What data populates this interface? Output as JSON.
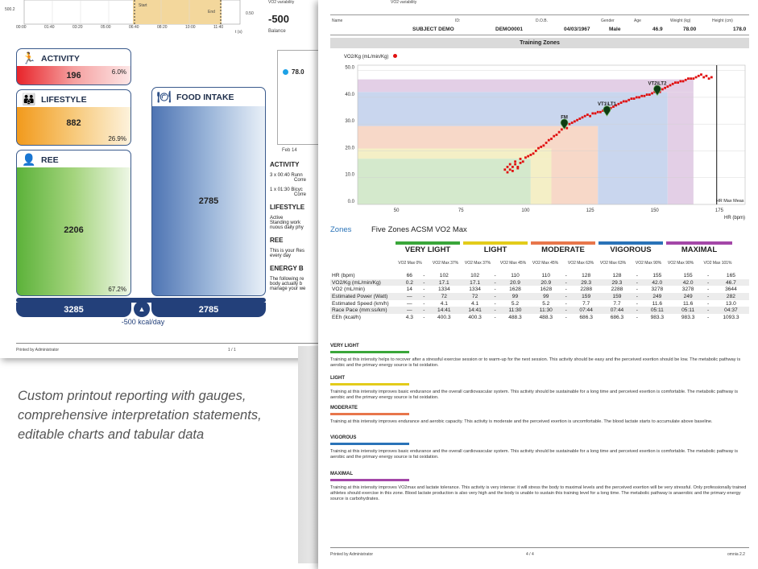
{
  "back": {
    "top_chart": {
      "y_tick_500": "500.2",
      "x_ticks": [
        "00:00",
        "01:40",
        "03:20",
        "05:00",
        "06:40",
        "08:20",
        "10:00",
        "11:40"
      ],
      "t_unit": "t (s)",
      "start_label": "Start",
      "end_label": "End",
      "right_tick": "0.50"
    },
    "balance_top_label": "VO2 variability",
    "balance_value": "-500",
    "balance_label": "Balance",
    "activity": {
      "label": "ACTIVITY",
      "value": "196",
      "pct": "6.0%"
    },
    "lifestyle": {
      "label": "LIFESTYLE",
      "value": "882",
      "pct": "26.9%"
    },
    "ree": {
      "label": "REE",
      "value": "2206",
      "pct": "67.2%"
    },
    "food": {
      "label": "FOOD INTAKE",
      "value": "2785"
    },
    "totals": {
      "left": "3285",
      "right": "2785",
      "balance": "-500 kcal/day"
    },
    "mini_chart": {
      "value": "78.0",
      "x_label": "Feb 14"
    },
    "side_sections": [
      {
        "title": "ACTIVITY",
        "lines": [
          "3 x 00:40  Runn",
          "Corre",
          "1 x 01:30  Bicyc",
          "Corre"
        ]
      },
      {
        "title": "LIFESTYLE",
        "lines": [
          "Active",
          "Standing work",
          "nuous daily phy"
        ]
      },
      {
        "title": "REE",
        "lines": [
          "This is your Res",
          "every day"
        ]
      },
      {
        "title": "ENERGY B",
        "lines": [
          "The following re",
          "body actually b",
          "manage your we"
        ]
      }
    ],
    "footer_left": "Printed by Administrator",
    "footer_page": "1 / 1"
  },
  "caption": "Custom printout reporting with gauges, comprehensive interpretation statements, editable charts and tabular data",
  "front": {
    "header_top_text": "VO2 variability",
    "subject": {
      "name_label": "Name",
      "name": "SUBJECT DEMO",
      "id_label": "ID:",
      "id": "DEMO0001",
      "dob_label": "D.O.B.",
      "dob": "04/03/1967",
      "gender_label": "Gender",
      "gender": "Male",
      "age_label": "Age",
      "age": "46.9",
      "weight_label": "Weight (kg)",
      "weight": "78.00",
      "height_label": "Height (cm)",
      "height": "178.0"
    },
    "section_title": "Training Zones",
    "zones_label": "Zones",
    "zones_title": "Five Zones ACSM VO2 Max",
    "zones": [
      {
        "name": "VERY LIGHT",
        "color": "#3aa63a",
        "sub1": "VO2 Max 0%",
        "sub2": "VO2 Max 37%"
      },
      {
        "name": "LIGHT",
        "color": "#e3cc1a",
        "sub1": "VO2 Max 37%",
        "sub2": "VO2 Max 45%"
      },
      {
        "name": "MODERATE",
        "color": "#e8764b",
        "sub1": "VO2 Max 45%",
        "sub2": "VO2 Max 63%"
      },
      {
        "name": "VIGOROUS",
        "color": "#2a73b8",
        "sub1": "VO2 Max 63%",
        "sub2": "VO2 Max 90%"
      },
      {
        "name": "MAXIMAL",
        "color": "#a447a8",
        "sub1": "VO2 Max 90%",
        "sub2": "VO2 Max 101%"
      }
    ],
    "table_rows": [
      {
        "label": "HR (bpm)",
        "cells": [
          "66",
          "-",
          "102",
          "102",
          "-",
          "110",
          "110",
          "-",
          "128",
          "128",
          "-",
          "155",
          "155",
          "-",
          "165"
        ]
      },
      {
        "label": "VO2/Kg (mL/min/Kg)",
        "cells": [
          "0.2",
          "-",
          "17.1",
          "17.1",
          "-",
          "20.9",
          "20.9",
          "-",
          "29.3",
          "29.3",
          "-",
          "42.0",
          "42.0",
          "-",
          "46.7"
        ]
      },
      {
        "label": "VO2 (mL/min)",
        "cells": [
          "14",
          "-",
          "1334",
          "1334",
          "-",
          "1628",
          "1628",
          "-",
          "2288",
          "2288",
          "-",
          "3278",
          "3278",
          "-",
          "3644"
        ]
      },
      {
        "label": "Estimated Power (Watt)",
        "cells": [
          "—",
          "-",
          "72",
          "72",
          "-",
          "99",
          "99",
          "-",
          "159",
          "159",
          "-",
          "249",
          "249",
          "-",
          "282"
        ]
      },
      {
        "label": "Estimated Speed (km/h)",
        "cells": [
          "—",
          "-",
          "4.1",
          "4.1",
          "-",
          "5.2",
          "5.2",
          "-",
          "7.7",
          "7.7",
          "-",
          "11.6",
          "11.6",
          "-",
          "13.0"
        ]
      },
      {
        "label": "Race Pace (mm:ss/km)",
        "cells": [
          "—",
          "-",
          "14:41",
          "14:41",
          "-",
          "11:30",
          "11:30",
          "-",
          "07:44",
          "07:44",
          "-",
          "05:11",
          "05:11",
          "-",
          "04:37"
        ]
      },
      {
        "label": "EEh (kcal/h)",
        "cells": [
          "4.3",
          "-",
          "400.3",
          "400.3",
          "-",
          "488.3",
          "488.3",
          "-",
          "686.3",
          "686.3",
          "-",
          "983.3",
          "983.3",
          "-",
          "1093.3"
        ]
      }
    ],
    "descriptions": [
      {
        "title": "VERY LIGHT",
        "color": "#3aa63a",
        "text": "Training at this intensity helps to recover after a stressful exercise session or to warm-up for the next session. This activity should be easy and the perceived exertion should be low. The metabolic pathway is aerobic and the primary energy source is fat oxidation."
      },
      {
        "title": "LIGHT",
        "color": "#e3cc1a",
        "text": "Training at this intensity improves basic endurance and the overall cardiovascular system. This activity should be sustainable for a long time and perceived exertion is comfortable. The metabolic pathway is aerobic and the primary energy source is fat oxidation."
      },
      {
        "title": "MODERATE",
        "color": "#e8764b",
        "text": "Training at this intensity improves endurance and aerobic capacity. This activity is moderate and the perceived exertion is uncomfortable. The blood lactate starts to accumulate above baseline."
      },
      {
        "title": "VIGOROUS",
        "color": "#2a73b8",
        "text": "Training at this intensity improves basic endurance and the overall cardiovascular system. This activity should be sustainable for a long time and perceived exertion is comfortable. The metabolic pathway is aerobic and the primary energy source is fat oxidation."
      },
      {
        "title": "MAXIMAL",
        "color": "#a447a8",
        "text": "Training at this intensity improves VO2max and lactate tolerance. This activity is very intense: it will stress the body to maximal levels and the perceived exertion will be very stressful. Only professionally trained athletes should exercise in this zone. Blood lactate production is also very high and the body is unable to sustain this training level for a long time. The metabolic pathway is anaerobic and the primary energy source is carbohydrates."
      }
    ],
    "footer_left": "Printed by Administrator",
    "footer_page": "4 / 4",
    "footer_right": "omnia 2.2"
  },
  "chart_data": {
    "type": "scatter",
    "ylabel": "VO2/Kg (mL/min/Kg)",
    "xlabel": "HR (bpm)",
    "xlim": [
      35,
      185
    ],
    "ylim": [
      0,
      52
    ],
    "x_ticks": [
      50,
      75,
      100,
      125,
      150,
      175
    ],
    "y_ticks": [
      "0.0",
      "10.0",
      "20.0",
      "30.0",
      "40.0",
      "50.0"
    ],
    "zone_hr_bounds": [
      102,
      110,
      128,
      155,
      165
    ],
    "zone_vo2_bounds": [
      17.1,
      20.9,
      29.3,
      42.0,
      46.7
    ],
    "zone_colors": [
      "#d4e9cc",
      "#f4efc6",
      "#f7d8c8",
      "#c9d6ee",
      "#e3cfe6"
    ],
    "markers": [
      {
        "label": "FM",
        "x": 115,
        "y": 29.6
      },
      {
        "label": "VT1\\LT1",
        "x": 131.5,
        "y": 34.5
      },
      {
        "label": "VT2\\LT2",
        "x": 151,
        "y": 42.2
      }
    ],
    "hr_max_line": {
      "x": 174,
      "label": "HR Max Meas"
    },
    "points": [
      [
        92,
        13
      ],
      [
        93,
        14
      ],
      [
        93,
        12
      ],
      [
        94,
        15
      ],
      [
        94,
        13
      ],
      [
        95,
        14
      ],
      [
        95,
        12.5
      ],
      [
        96,
        15
      ],
      [
        96,
        16
      ],
      [
        97,
        14
      ],
      [
        97,
        13.5
      ],
      [
        98,
        15.5
      ],
      [
        98,
        17
      ],
      [
        99,
        16
      ],
      [
        100,
        17.5
      ],
      [
        101,
        18
      ],
      [
        102,
        18.5
      ],
      [
        103,
        19
      ],
      [
        104,
        20
      ],
      [
        105,
        21
      ],
      [
        106,
        21.5
      ],
      [
        107,
        22
      ],
      [
        108,
        23
      ],
      [
        109,
        24
      ],
      [
        110,
        24.5
      ],
      [
        111,
        25.5
      ],
      [
        112,
        26
      ],
      [
        113,
        27
      ],
      [
        114,
        28
      ],
      [
        115,
        29.5
      ],
      [
        116,
        28.5
      ],
      [
        117,
        30
      ],
      [
        118,
        30.5
      ],
      [
        119,
        31
      ],
      [
        120,
        31.5
      ],
      [
        121,
        32
      ],
      [
        122,
        32.5
      ],
      [
        123,
        33
      ],
      [
        124,
        33.5
      ],
      [
        125,
        33
      ],
      [
        126,
        34
      ],
      [
        127,
        34
      ],
      [
        128,
        34.5
      ],
      [
        129,
        34.5
      ],
      [
        130,
        35
      ],
      [
        131,
        35
      ],
      [
        132,
        35.5
      ],
      [
        133,
        36
      ],
      [
        134,
        36.5
      ],
      [
        135,
        37
      ],
      [
        136,
        37.5
      ],
      [
        137,
        38
      ],
      [
        138,
        38.5
      ],
      [
        139,
        38.5
      ],
      [
        140,
        39
      ],
      [
        141,
        39.5
      ],
      [
        142,
        39.5
      ],
      [
        143,
        40
      ],
      [
        144,
        40
      ],
      [
        145,
        40.5
      ],
      [
        146,
        40.5
      ],
      [
        147,
        41
      ],
      [
        148,
        41
      ],
      [
        149,
        41.5
      ],
      [
        150,
        42
      ],
      [
        151,
        42.5
      ],
      [
        152,
        42
      ],
      [
        153,
        43
      ],
      [
        154,
        43.5
      ],
      [
        155,
        44
      ],
      [
        156,
        44.5
      ],
      [
        157,
        45
      ],
      [
        158,
        45.5
      ],
      [
        159,
        45.5
      ],
      [
        160,
        46
      ],
      [
        161,
        46
      ],
      [
        162,
        46.5
      ],
      [
        163,
        47
      ],
      [
        164,
        47
      ],
      [
        165,
        47
      ],
      [
        166,
        47.5
      ],
      [
        167,
        48
      ],
      [
        168,
        48.5
      ],
      [
        169,
        47.5
      ],
      [
        170,
        48
      ],
      [
        171,
        47
      ],
      [
        172,
        47.5
      ]
    ]
  }
}
